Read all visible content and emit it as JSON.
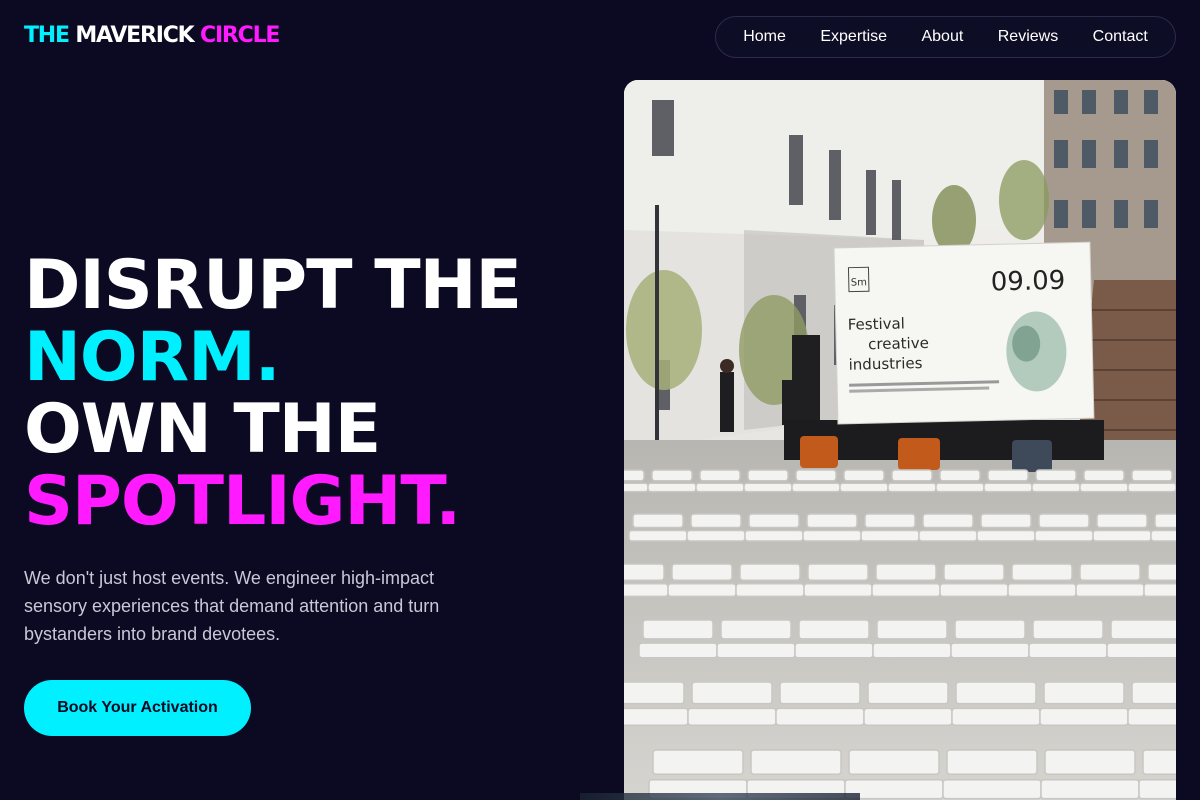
{
  "brand": {
    "part1": "THE",
    "part2": "MAVERICK",
    "part3": "CIRCLE"
  },
  "nav": {
    "items": [
      "Home",
      "Expertise",
      "About",
      "Reviews",
      "Contact"
    ]
  },
  "hero": {
    "line1": "DISRUPT THE",
    "line2": "NORM.",
    "line3": "OWN THE",
    "line4": "SPOTLIGHT.",
    "subtitle": "We don't just host events. We engineer high-impact sensory experiences that demand attention and turn bystanders into brand devotees.",
    "cta_label": "Book Your Activation"
  },
  "photo": {
    "screen_logo": "Sm",
    "screen_date": "09.09",
    "screen_title_1": "Festival",
    "screen_title_2": "creative",
    "screen_title_3": "industries"
  },
  "colors": {
    "background": "#0b0a22",
    "accent_cyan": "#00f0ff",
    "accent_magenta": "#ff1aff"
  }
}
